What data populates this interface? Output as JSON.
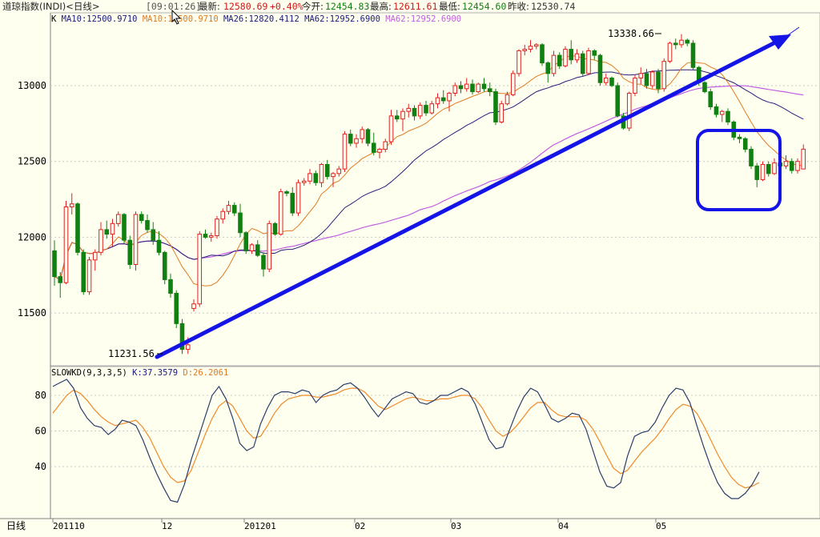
{
  "header": {
    "title": "道琼指数(INDI)<日线>",
    "time": "[09:01:26]",
    "latest_label": "最新:",
    "latest_value": "12580.69",
    "change": "+0.40%",
    "open_label": "今开:",
    "open_value": "12454.83",
    "high_label": "最高:",
    "high_value": "12611.61",
    "low_label": "最低:",
    "low_value": "12454.60",
    "prev_label": "昨收:",
    "prev_value": "12530.74"
  },
  "price_legend": {
    "k": "K",
    "ma10": "MA10:12500.9710",
    "ma10b": "MA10:12500.9710",
    "ma26": "MA26:12820.4112",
    "ma62": "MA62:12952.6900",
    "ma62b": "MA62:12952.6900"
  },
  "kd_legend": {
    "name": "SLOWKD(9,3,3,5)",
    "k": "K:37.3579",
    "d": "D:26.2061"
  },
  "annotations": {
    "low_label": "11231.56",
    "high_label": "13338.66"
  },
  "colors": {
    "up": "#e02020",
    "down": "#108010",
    "ma10": "#e07a20",
    "ma26": "#2a1e7a",
    "ma62": "#c060e0",
    "trendline": "#1414e6",
    "k_line": "#2a3e6a",
    "d_line": "#f08a2a",
    "background": "#fffff0",
    "grid": "#c8c8c8"
  },
  "footer": {
    "period_label": "日线",
    "x_ticks": [
      "201110",
      "12",
      "201201",
      "02",
      "03",
      "04",
      "05"
    ]
  },
  "nav_icons": [
    "zoom-in-icon",
    "zoom-out-icon",
    "scroll-left-icon",
    "scroll-right-icon"
  ],
  "chart_data": [
    {
      "type": "candlestick",
      "title": "",
      "y_ticks": [
        11500,
        12000,
        12500,
        13000
      ],
      "ylim": [
        11150,
        13450
      ],
      "grid": "horizontal dashed",
      "highest_marked": 13338.66,
      "lowest_marked": 11231.56,
      "candles": [
        [
          11910,
          11980,
          11680,
          11740
        ],
        [
          11740,
          11770,
          11600,
          11700
        ],
        [
          11700,
          12240,
          11690,
          12200
        ],
        [
          12200,
          12290,
          12150,
          12220
        ],
        [
          12220,
          12230,
          11880,
          11900
        ],
        [
          11900,
          11920,
          11620,
          11640
        ],
        [
          11640,
          11870,
          11620,
          11850
        ],
        [
          11850,
          11920,
          11780,
          11900
        ],
        [
          11900,
          12100,
          11880,
          12050
        ],
        [
          12050,
          12110,
          11990,
          12020
        ],
        [
          12020,
          12120,
          11940,
          12090
        ],
        [
          12090,
          12170,
          12070,
          12150
        ],
        [
          12150,
          12160,
          11960,
          11980
        ],
        [
          11980,
          12010,
          11790,
          11820
        ],
        [
          11820,
          12170,
          11780,
          12150
        ],
        [
          12150,
          12170,
          12090,
          12110
        ],
        [
          12110,
          12150,
          12030,
          12050
        ],
        [
          12050,
          12100,
          11950,
          11980
        ],
        [
          11980,
          12040,
          11880,
          11900
        ],
        [
          11900,
          11910,
          11690,
          11720
        ],
        [
          11720,
          11760,
          11600,
          11630
        ],
        [
          11630,
          11650,
          11400,
          11430
        ],
        [
          11430,
          11460,
          11230,
          11260
        ],
        [
          11260,
          11340,
          11230,
          11290
        ],
        [
          11530,
          11590,
          11510,
          11560
        ],
        [
          11560,
          12040,
          11540,
          12020
        ],
        [
          12020,
          12050,
          11990,
          12000
        ],
        [
          12000,
          12030,
          11970,
          12010
        ],
        [
          12010,
          12140,
          11990,
          12120
        ],
        [
          12120,
          12190,
          12090,
          12170
        ],
        [
          12170,
          12240,
          12150,
          12210
        ],
        [
          12210,
          12230,
          12140,
          12160
        ],
        [
          12160,
          12220,
          12000,
          12030
        ],
        [
          12030,
          12040,
          11890,
          11910
        ],
        [
          11910,
          11960,
          11890,
          11950
        ],
        [
          11950,
          11980,
          11870,
          11880
        ],
        [
          11880,
          11900,
          11740,
          11790
        ],
        [
          11790,
          12110,
          11770,
          12090
        ],
        [
          12090,
          12100,
          12010,
          12020
        ],
        [
          12020,
          12320,
          12010,
          12300
        ],
        [
          12300,
          12310,
          12270,
          12290
        ],
        [
          12290,
          12330,
          12140,
          12160
        ],
        [
          12160,
          12380,
          12140,
          12360
        ],
        [
          12360,
          12390,
          12340,
          12370
        ],
        [
          12370,
          12450,
          12350,
          12420
        ],
        [
          12420,
          12440,
          12340,
          12360
        ],
        [
          12360,
          12490,
          12330,
          12480
        ],
        [
          12480,
          12510,
          12380,
          12400
        ],
        [
          12400,
          12430,
          12330,
          12420
        ],
        [
          12420,
          12470,
          12400,
          12450
        ],
        [
          12450,
          12700,
          12430,
          12680
        ],
        [
          12680,
          12710,
          12600,
          12620
        ],
        [
          12620,
          12680,
          12590,
          12650
        ],
        [
          12650,
          12730,
          12620,
          12710
        ],
        [
          12710,
          12720,
          12600,
          12620
        ],
        [
          12620,
          12690,
          12540,
          12560
        ],
        [
          12560,
          12590,
          12520,
          12580
        ],
        [
          12580,
          12650,
          12560,
          12630
        ],
        [
          12630,
          12840,
          12610,
          12800
        ],
        [
          12800,
          12840,
          12760,
          12780
        ],
        [
          12780,
          12850,
          12700,
          12830
        ],
        [
          12830,
          12880,
          12790,
          12850
        ],
        [
          12850,
          12870,
          12770,
          12800
        ],
        [
          12800,
          12890,
          12780,
          12870
        ],
        [
          12870,
          12900,
          12800,
          12820
        ],
        [
          12820,
          12900,
          12810,
          12880
        ],
        [
          12880,
          12950,
          12850,
          12920
        ],
        [
          12920,
          12970,
          12880,
          12900
        ],
        [
          12900,
          12960,
          12830,
          12950
        ],
        [
          12950,
          13020,
          12930,
          13000
        ],
        [
          13000,
          13030,
          12950,
          12980
        ],
        [
          12980,
          13050,
          12960,
          13010
        ],
        [
          13010,
          13040,
          12940,
          12960
        ],
        [
          12960,
          13020,
          12950,
          13010
        ],
        [
          13010,
          13050,
          12960,
          12980
        ],
        [
          12980,
          13020,
          12930,
          12960
        ],
        [
          12960,
          12980,
          12740,
          12760
        ],
        [
          12760,
          12900,
          12750,
          12880
        ],
        [
          12880,
          12960,
          12870,
          12940
        ],
        [
          12940,
          13100,
          12930,
          13080
        ],
        [
          13080,
          13240,
          13060,
          13230
        ],
        [
          13230,
          13270,
          13200,
          13240
        ],
        [
          13240,
          13300,
          13220,
          13260
        ],
        [
          13260,
          13280,
          13240,
          13270
        ],
        [
          13270,
          13280,
          13130,
          13150
        ],
        [
          13150,
          13160,
          13020,
          13080
        ],
        [
          13080,
          13230,
          13060,
          13200
        ],
        [
          13200,
          13220,
          13110,
          13130
        ],
        [
          13130,
          13260,
          13120,
          13240
        ],
        [
          13240,
          13300,
          13140,
          13170
        ],
        [
          13170,
          13240,
          13150,
          13210
        ],
        [
          13210,
          13230,
          13060,
          13080
        ],
        [
          13080,
          13250,
          13070,
          13230
        ],
        [
          13230,
          13240,
          13170,
          13200
        ],
        [
          13200,
          13210,
          13000,
          13020
        ],
        [
          13020,
          13080,
          13000,
          13050
        ],
        [
          13050,
          13060,
          12990,
          13000
        ],
        [
          13000,
          13020,
          12790,
          12800
        ],
        [
          12800,
          12820,
          12710,
          12720
        ],
        [
          12720,
          12960,
          12700,
          12950
        ],
        [
          12950,
          13070,
          12930,
          13050
        ],
        [
          13050,
          13120,
          13010,
          13080
        ],
        [
          13080,
          13110,
          12980,
          13000
        ],
        [
          13000,
          13100,
          12980,
          13090
        ],
        [
          13090,
          13110,
          12950,
          12980
        ],
        [
          12980,
          13180,
          12960,
          13160
        ],
        [
          13160,
          13290,
          13150,
          13280
        ],
        [
          13280,
          13310,
          13240,
          13270
        ],
        [
          13270,
          13340,
          13250,
          13300
        ],
        [
          13300,
          13310,
          13260,
          13280
        ],
        [
          13280,
          13300,
          13100,
          13120
        ],
        [
          13120,
          13130,
          13000,
          13020
        ],
        [
          13020,
          13030,
          12950,
          12960
        ],
        [
          12960,
          12980,
          12840,
          12860
        ],
        [
          12860,
          12880,
          12790,
          12810
        ],
        [
          12810,
          12840,
          12760,
          12830
        ],
        [
          12830,
          12850,
          12740,
          12760
        ],
        [
          12760,
          12770,
          12640,
          12660
        ],
        [
          12660,
          12680,
          12620,
          12650
        ],
        [
          12650,
          12660,
          12560,
          12580
        ],
        [
          12580,
          12600,
          12450,
          12470
        ],
        [
          12470,
          12490,
          12330,
          12380
        ],
        [
          12380,
          12500,
          12370,
          12480
        ],
        [
          12480,
          12500,
          12400,
          12420
        ],
        [
          12420,
          12520,
          12410,
          12490
        ],
        [
          12490,
          12510,
          12310,
          12470
        ],
        [
          12470,
          12540,
          12450,
          12500
        ],
        [
          12500,
          12520,
          12420,
          12440
        ],
        [
          12440,
          12520,
          12420,
          12500
        ],
        [
          12450,
          12612,
          12450,
          12581
        ]
      ]
    },
    {
      "type": "line",
      "title": "SLOWKD(9,3,3,5)",
      "y_ticks": [
        40,
        60,
        80
      ],
      "ylim": [
        17,
        91
      ],
      "grid": "horizontal dashed",
      "series": [
        {
          "name": "K",
          "values": [
            85,
            87,
            89,
            84,
            73,
            67,
            63,
            62,
            58,
            61,
            66,
            65,
            63,
            55,
            45,
            36,
            28,
            21,
            20,
            30,
            44,
            56,
            68,
            80,
            85,
            78,
            67,
            53,
            49,
            51,
            64,
            73,
            80,
            82,
            82,
            81,
            83,
            82,
            76,
            80,
            82,
            83,
            86,
            87,
            84,
            79,
            73,
            68,
            73,
            78,
            80,
            82,
            81,
            76,
            75,
            77,
            80,
            80,
            82,
            84,
            82,
            75,
            65,
            55,
            50,
            51,
            61,
            71,
            79,
            84,
            82,
            75,
            67,
            65,
            67,
            70,
            69,
            61,
            49,
            37,
            29,
            28,
            31,
            46,
            57,
            59,
            60,
            65,
            73,
            80,
            84,
            83,
            76,
            63,
            51,
            40,
            31,
            25,
            22,
            22,
            25,
            30,
            37
          ]
        },
        {
          "name": "D",
          "values": [
            70,
            75,
            80,
            83,
            81,
            77,
            72,
            68,
            65,
            63,
            64,
            65,
            66,
            62,
            56,
            48,
            40,
            34,
            31,
            32,
            38,
            48,
            58,
            67,
            74,
            77,
            74,
            67,
            60,
            56,
            57,
            63,
            70,
            75,
            78,
            79,
            80,
            80,
            79,
            79,
            80,
            81,
            83,
            84,
            84,
            82,
            78,
            74,
            72,
            74,
            76,
            78,
            79,
            78,
            77,
            77,
            78,
            78,
            79,
            80,
            80,
            78,
            73,
            66,
            60,
            57,
            59,
            63,
            68,
            73,
            76,
            76,
            72,
            69,
            68,
            68,
            68,
            66,
            61,
            54,
            46,
            39,
            36,
            38,
            43,
            48,
            52,
            56,
            61,
            67,
            72,
            75,
            74,
            70,
            63,
            55,
            47,
            40,
            34,
            30,
            28,
            29,
            31
          ]
        }
      ]
    }
  ]
}
